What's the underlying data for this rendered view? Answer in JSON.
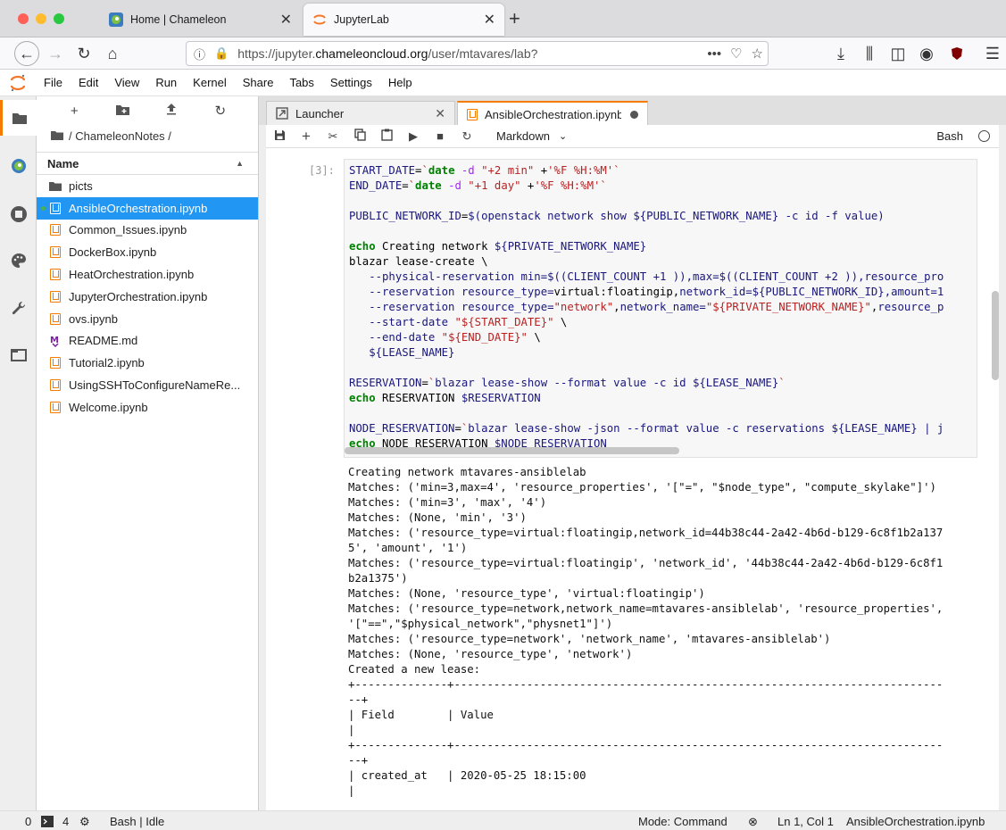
{
  "browser": {
    "tabs": [
      {
        "title": "Home | Chameleon"
      },
      {
        "title": "JupyterLab"
      }
    ],
    "new_tab": "+",
    "url_prefix": "https://jupyter.",
    "url_domain": "chameleoncloud.org",
    "url_path": "/user/mtavares/lab?",
    "url_actions": "•••"
  },
  "menu": [
    "File",
    "Edit",
    "View",
    "Run",
    "Kernel",
    "Share",
    "Tabs",
    "Settings",
    "Help"
  ],
  "filebrowser": {
    "breadcrumb": "/ ChameleonNotes /",
    "column": "Name",
    "files": [
      {
        "name": "picts",
        "type": "folder"
      },
      {
        "name": "AnsibleOrchestration.ipynb",
        "type": "notebook",
        "selected": true
      },
      {
        "name": "Common_Issues.ipynb",
        "type": "notebook"
      },
      {
        "name": "DockerBox.ipynb",
        "type": "notebook"
      },
      {
        "name": "HeatOrchestration.ipynb",
        "type": "notebook"
      },
      {
        "name": "JupyterOrchestration.ipynb",
        "type": "notebook"
      },
      {
        "name": "ovs.ipynb",
        "type": "notebook"
      },
      {
        "name": "README.md",
        "type": "markdown"
      },
      {
        "name": "Tutorial2.ipynb",
        "type": "notebook"
      },
      {
        "name": "UsingSSHToConfigureNameRe...",
        "type": "notebook"
      },
      {
        "name": "Welcome.ipynb",
        "type": "notebook"
      }
    ]
  },
  "doctabs": [
    {
      "label": "Launcher"
    },
    {
      "label": "AnsibleOrchestration.ipynb"
    }
  ],
  "toolbar": {
    "cell_type": "Markdown",
    "kernel": "Bash"
  },
  "cell": {
    "prompt": "[3]:",
    "output": "Creating network mtavares-ansiblelab\nMatches: ('min=3,max=4', 'resource_properties', '[\"=\", \"$node_type\", \"compute_skylake\"]')\nMatches: ('min=3', 'max', '4')\nMatches: (None, 'min', '3')\nMatches: ('resource_type=virtual:floatingip,network_id=44b38c44-2a42-4b6d-b129-6c8f1b2a137\n5', 'amount', '1')\nMatches: ('resource_type=virtual:floatingip', 'network_id', '44b38c44-2a42-4b6d-b129-6c8f1\nb2a1375')\nMatches: (None, 'resource_type', 'virtual:floatingip')\nMatches: ('resource_type=network,network_name=mtavares-ansiblelab', 'resource_properties',\n'[\"==\",\"$physical_network\",\"physnet1\"]')\nMatches: ('resource_type=network', 'network_name', 'mtavares-ansiblelab')\nMatches: (None, 'resource_type', 'network')\nCreated a new lease:\n+--------------+--------------------------------------------------------------------------\n--+\n| Field        | Value\n|\n+--------------+--------------------------------------------------------------------------\n--+\n| created_at   | 2020-05-25 18:15:00\n|"
  },
  "status": {
    "terminals": "0",
    "kernels": "4",
    "kernel_state": "Bash | Idle",
    "mode": "Mode: Command",
    "position": "Ln 1, Col 1",
    "file": "AnsibleOrchestration.ipynb"
  }
}
